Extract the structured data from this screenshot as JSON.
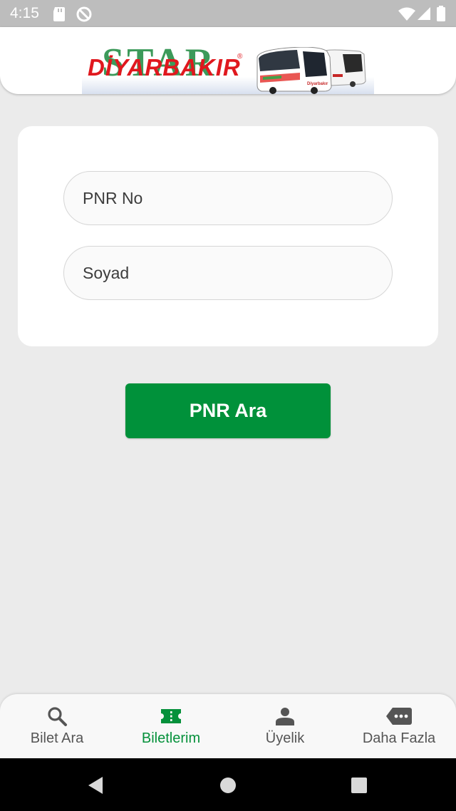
{
  "status_bar": {
    "time": "4:15",
    "icons": [
      "sd-card-icon",
      "do-not-disturb-icon",
      "wifi-icon",
      "signal-icon",
      "battery-icon"
    ]
  },
  "header": {
    "logo_star_text": "STAR",
    "logo_brand_text": "DİYARBAKIR",
    "logo_reg_mark": "®",
    "logo_image": "bus-photo"
  },
  "form": {
    "pnr_placeholder": "PNR No",
    "pnr_value": "",
    "surname_placeholder": "Soyad",
    "surname_value": ""
  },
  "search_button_label": "PNR Ara",
  "bottom_nav": {
    "active_index": 1,
    "items": [
      {
        "label": "Bilet Ara",
        "icon": "search-icon"
      },
      {
        "label": "Biletlerim",
        "icon": "ticket-icon"
      },
      {
        "label": "Üyelik",
        "icon": "person-icon"
      },
      {
        "label": "Daha Fazla",
        "icon": "more-icon"
      }
    ]
  },
  "colors": {
    "accent_green": "#00913a",
    "active_tab": "#05913b",
    "inactive_tab": "#555555",
    "background": "#ebebeb",
    "brand_red": "#e0181e"
  }
}
